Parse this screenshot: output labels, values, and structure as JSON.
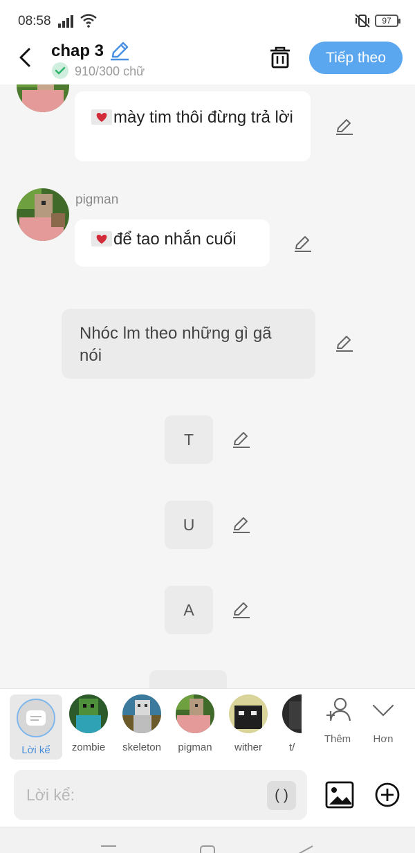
{
  "status": {
    "time": "08:58",
    "battery": "97"
  },
  "header": {
    "title": "chap 3",
    "word_count": "910/300 chữ",
    "next_label": "Tiếp theo"
  },
  "messages": [
    {
      "text": "mày tim thôi đừng trả lời",
      "heart": true
    },
    {
      "sender": "pigman",
      "text": "để tao nhắn cuối",
      "heart": true
    },
    {
      "text": "Nhóc lm theo những gì gã nói"
    },
    {
      "text": "T"
    },
    {
      "text": "U"
    },
    {
      "text": "A"
    }
  ],
  "characters": [
    {
      "name": "Lời kể",
      "selected": true
    },
    {
      "name": "zombie"
    },
    {
      "name": "skeleton"
    },
    {
      "name": "pigman"
    },
    {
      "name": "wither"
    },
    {
      "name": "t/"
    }
  ],
  "char_actions": {
    "add_label": "Thêm",
    "more_label": "Hơn"
  },
  "input": {
    "placeholder": "Lời kể:",
    "paren_label": "( )"
  },
  "colors": {
    "accent": "#5aa7f0",
    "selected_name": "#4a8fdc"
  }
}
